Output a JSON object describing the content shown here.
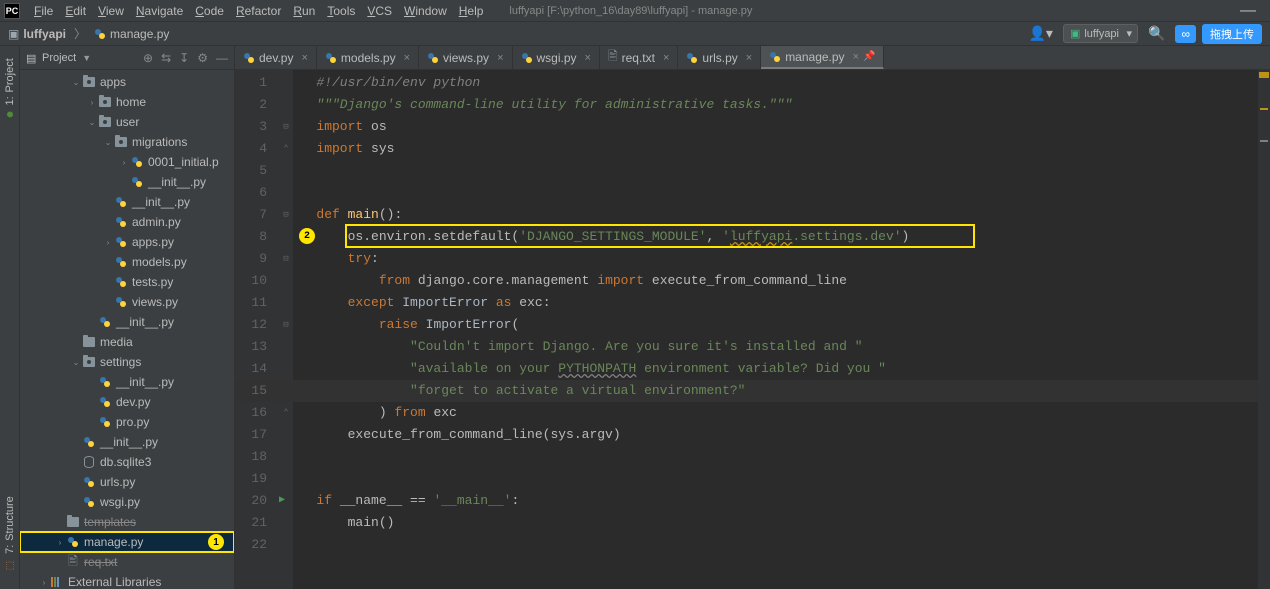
{
  "menu": {
    "items": [
      "File",
      "Edit",
      "View",
      "Navigate",
      "Code",
      "Refactor",
      "Run",
      "Tools",
      "VCS",
      "Window",
      "Help"
    ],
    "title": "luffyapi [F:\\python_16\\day89\\luffyapi] - manage.py"
  },
  "breadcrumb": {
    "root": "luffyapi",
    "file": "manage.py"
  },
  "toolbar": {
    "run_config": "luffyapi",
    "upload_label": "拖拽上传"
  },
  "left_vertical_tabs": {
    "project": "Project",
    "structure": "Structure"
  },
  "sidebar": {
    "header": "Project",
    "tree": [
      {
        "depth": 2,
        "expander": "v",
        "icon": "folder-pkg",
        "label": "apps"
      },
      {
        "depth": 3,
        "expander": ">",
        "icon": "folder-pkg",
        "label": "home"
      },
      {
        "depth": 3,
        "expander": "v",
        "icon": "folder-pkg",
        "label": "user"
      },
      {
        "depth": 4,
        "expander": "v",
        "icon": "folder-pkg",
        "label": "migrations"
      },
      {
        "depth": 5,
        "expander": ">",
        "icon": "py",
        "label": "0001_initial.p"
      },
      {
        "depth": 5,
        "expander": "",
        "icon": "py",
        "label": "__init__.py"
      },
      {
        "depth": 4,
        "expander": "",
        "icon": "py",
        "label": "__init__.py"
      },
      {
        "depth": 4,
        "expander": "",
        "icon": "py",
        "label": "admin.py"
      },
      {
        "depth": 4,
        "expander": ">",
        "icon": "py",
        "label": "apps.py"
      },
      {
        "depth": 4,
        "expander": "",
        "icon": "py",
        "label": "models.py"
      },
      {
        "depth": 4,
        "expander": "",
        "icon": "py",
        "label": "tests.py"
      },
      {
        "depth": 4,
        "expander": "",
        "icon": "py",
        "label": "views.py"
      },
      {
        "depth": 3,
        "expander": "",
        "icon": "py",
        "label": "__init__.py"
      },
      {
        "depth": 2,
        "expander": "",
        "icon": "folder",
        "label": "media"
      },
      {
        "depth": 2,
        "expander": "v",
        "icon": "folder-pkg",
        "label": "settings"
      },
      {
        "depth": 3,
        "expander": "",
        "icon": "py",
        "label": "__init__.py"
      },
      {
        "depth": 3,
        "expander": "",
        "icon": "py",
        "label": "dev.py"
      },
      {
        "depth": 3,
        "expander": "",
        "icon": "py",
        "label": "pro.py"
      },
      {
        "depth": 2,
        "expander": "",
        "icon": "py",
        "label": "__init__.py"
      },
      {
        "depth": 2,
        "expander": "",
        "icon": "db",
        "label": "db.sqlite3"
      },
      {
        "depth": 2,
        "expander": "",
        "icon": "py",
        "label": "urls.py"
      },
      {
        "depth": 2,
        "expander": "",
        "icon": "py",
        "label": "wsgi.py"
      },
      {
        "depth": 1,
        "expander": "",
        "icon": "folder",
        "label": "templates",
        "strike": true
      },
      {
        "depth": 1,
        "expander": ">",
        "icon": "py",
        "label": "manage.py",
        "highlighted": true,
        "badge": "1"
      },
      {
        "depth": 1,
        "expander": "",
        "icon": "txt",
        "label": "req.txt",
        "strike": true
      },
      {
        "depth": 0,
        "expander": ">",
        "icon": "lib",
        "label": "External Libraries"
      }
    ]
  },
  "tabs": [
    {
      "label": "dev.py",
      "icon": "py"
    },
    {
      "label": "models.py",
      "icon": "py"
    },
    {
      "label": "views.py",
      "icon": "py"
    },
    {
      "label": "wsgi.py",
      "icon": "py"
    },
    {
      "label": "req.txt",
      "icon": "txt"
    },
    {
      "label": "urls.py",
      "icon": "py"
    },
    {
      "label": "manage.py",
      "icon": "py",
      "active": true,
      "pinned": true
    }
  ],
  "editor": {
    "lines": [
      {
        "n": 1,
        "html": "<span class=\"cmnt\">#!/usr/bin/env python</span>"
      },
      {
        "n": 2,
        "html": "<span class=\"doc\">\"\"\"Django's command-line utility for administrative tasks.\"\"\"</span>"
      },
      {
        "n": 3,
        "html": "<span class=\"kw\">import</span> os",
        "fold": "-"
      },
      {
        "n": 4,
        "html": "<span class=\"kw\">import</span> sys",
        "fold": "^"
      },
      {
        "n": 5,
        "html": ""
      },
      {
        "n": 6,
        "html": ""
      },
      {
        "n": 7,
        "html": "<span class=\"kw\">def</span> <span class=\"fn\">main</span>():",
        "fold": "-"
      },
      {
        "n": 8,
        "html": "    os.environ.setdefault(<span class=\"str\">'DJANGO_SETTINGS_MODULE'</span>, <span class=\"str\">'<span class=\"warn-underline\">luffyapi</span>.settings.dev'</span>)"
      },
      {
        "n": 9,
        "html": "    <span class=\"kw\">try</span>:",
        "fold": "-"
      },
      {
        "n": 10,
        "html": "        <span class=\"kw\">from</span> django.core.management <span class=\"kw\">import</span> execute_from_command_line"
      },
      {
        "n": 11,
        "html": "    <span class=\"kw\">except</span> <span class=\"param\">ImportError</span> <span class=\"kw\">as</span> exc:"
      },
      {
        "n": 12,
        "html": "        <span class=\"kw\">raise</span> <span class=\"param\">ImportError</span>(",
        "fold": "-"
      },
      {
        "n": 13,
        "html": "            <span class=\"str\">\"Couldn't import Django. Are you sure it's installed and \"</span>"
      },
      {
        "n": 14,
        "html": "            <span class=\"str\">\"available on your <span class=\"err-underline\">PYTHONPATH</span> environment variable? Did you \"</span>"
      },
      {
        "n": 15,
        "html": "            <span class=\"str\">\"forget to activate a virtual environment?\"</span>"
      },
      {
        "n": 16,
        "html": "        ) <span class=\"kw\">from</span> exc",
        "fold": "^"
      },
      {
        "n": 17,
        "html": "    execute_from_command_line(sys.argv)"
      },
      {
        "n": 18,
        "html": ""
      },
      {
        "n": 19,
        "html": ""
      },
      {
        "n": 20,
        "html": "<span class=\"kw\">if</span> __name__ == <span class=\"str\">'__main__'</span>:",
        "run": true
      },
      {
        "n": 21,
        "html": "    main()"
      },
      {
        "n": 22,
        "html": ""
      }
    ],
    "highlight_line": 8,
    "highlight_badge": "2",
    "current_line": 15
  }
}
